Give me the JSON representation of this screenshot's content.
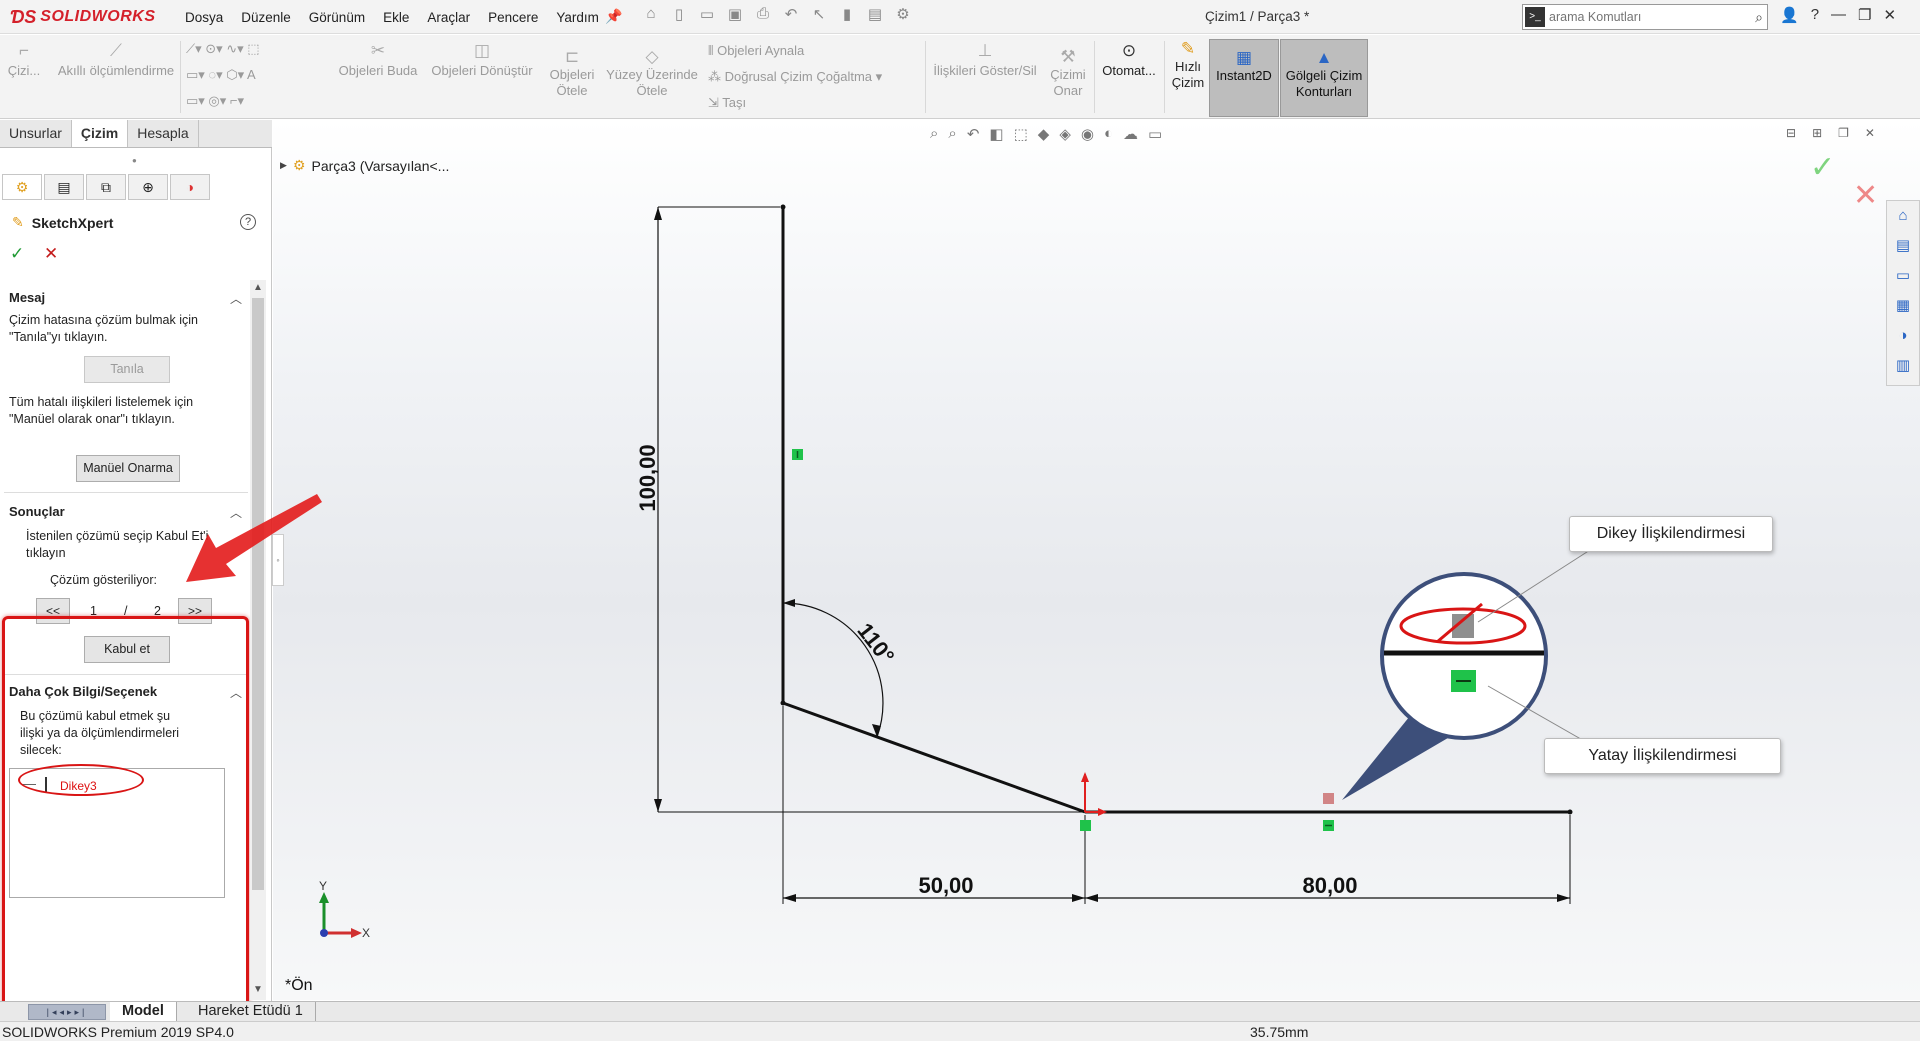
{
  "app": {
    "brand": "SOLIDWORKS",
    "brand_color": "#d4202a",
    "doc_title": "Çizim1 / Parça3 *"
  },
  "menu": [
    "Dosya",
    "Düzenle",
    "Görünüm",
    "Ekle",
    "Araçlar",
    "Pencere",
    "Yardım"
  ],
  "search": {
    "placeholder": "arama Komutları"
  },
  "ribbon": {
    "sketch_label": "Çizi...",
    "smart_dim_label": "Akıllı ölçümlendirme",
    "trim_label": "Objeleri Buda",
    "convert_label": "Objeleri Dönüştür",
    "offset_label": "Objeleri Ötele",
    "offset_surface_label": "Yüzey Üzerinde Ötele",
    "mirror_label": "Objeleri Aynala",
    "linear_pattern_label": "Doğrusal Çizim Çoğaltma",
    "move_label": "Taşı",
    "relations_label": "İlişkileri Göster/Sil",
    "repair_label": "Çizimi Onar",
    "auto_label": "Otomat...",
    "rapid_label": "Hızlı Çizim",
    "instant2d_label": "Instant2D",
    "shaded_label": "Gölgeli Çizim Konturları"
  },
  "panel": {
    "tabs": [
      "Unsurlar",
      "Çizim",
      "Hesapla"
    ],
    "active_tab": "Çizim",
    "title": "SketchXpert",
    "msg_group": "Mesaj",
    "msg_text_1": "Çizim hatasına çözüm bulmak için \"Tanıla\"yı tıklayın.",
    "diagnose_button": "Tanıla",
    "msg_text_2": "Tüm hatalı ilişkileri listelemek için \"Manüel olarak onar\"ı tıklayın.",
    "manual_repair_button": "Manüel Onarma",
    "results_group": "Sonuçlar",
    "results_text": "İstenilen çözümü seçip Kabul Et'i tıklayın",
    "showing_label": "Çözüm gösteriliyor:",
    "prev_button": "<<",
    "next_button": ">>",
    "current_solution": "1",
    "separator": "/",
    "total_solutions": "2",
    "accept_button": "Kabul et",
    "more_group": "Daha Çok Bilgi/Seçenek",
    "more_text": "Bu çözümü kabul etmek şu ilişki ya da ölçümlendirmeleri silecek:",
    "list_items": [
      "Dikey3"
    ]
  },
  "graphics": {
    "tree_label": "Parça3  (Varsayılan<...",
    "view_name": "*Ön",
    "dim_vertical": "100,00",
    "dim_angle": "110°",
    "dim_h1": "50,00",
    "dim_h2": "80,00",
    "callout_vertical": "Dikey İlişkilendirmesi",
    "callout_horizontal": "Yatay İlişkilendirmesi",
    "axis_x": "X",
    "axis_y": "Y"
  },
  "bottom_tabs": [
    "Model",
    "Hareket Etüdü 1"
  ],
  "status": {
    "product": "SOLIDWORKS Premium 2019 SP4.0",
    "measure": "35.75mm"
  },
  "colors": {
    "relation_green": "#1fc24a",
    "highlight_red": "#d91515",
    "dim_line": "#111111"
  }
}
